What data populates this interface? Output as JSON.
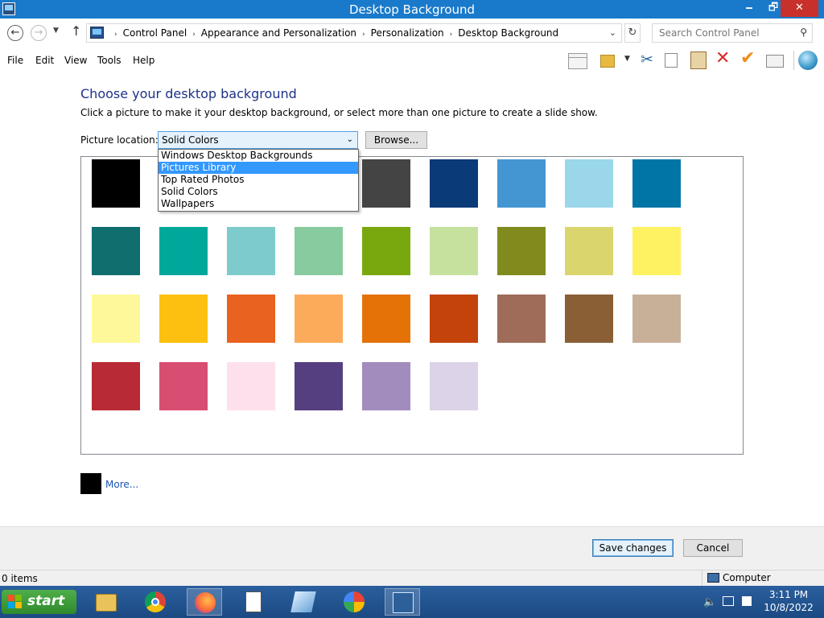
{
  "window": {
    "title": "Desktop Background",
    "minimize": "🗕",
    "maximize": "🗗",
    "close": "✕"
  },
  "address": {
    "crumbs": [
      "Control Panel",
      "Appearance and Personalization",
      "Personalization",
      "Desktop Background"
    ],
    "search_placeholder": "Search Control Panel"
  },
  "menu": {
    "file": "File",
    "edit": "Edit",
    "view": "View",
    "tools": "Tools",
    "help": "Help"
  },
  "main": {
    "heading": "Choose your desktop background",
    "subtext": "Click a picture to make it your desktop background, or select more than one picture to create a slide show.",
    "picture_location_label": "Picture location:",
    "picture_location_value": "Solid Colors",
    "browse_label": "Browse...",
    "dropdown_options": [
      "Windows Desktop Backgrounds",
      "Pictures Library",
      "Top Rated Photos",
      "Solid Colors",
      "Wallpapers"
    ],
    "dropdown_highlighted": "Pictures Library",
    "more_label": "More...",
    "more_color": "#000000"
  },
  "swatches": [
    [
      "#000000",
      "#ffffff",
      "#ffffff",
      "#ffffff",
      "#444444",
      "#0a3a78",
      "#4496d2",
      "#9bd7ea",
      "#0075a6"
    ],
    [
      "#106e6e",
      "#00a89c",
      "#7ecbcb",
      "#87cb9f",
      "#78a80d",
      "#c6e09e",
      "#818a1d",
      "#dbd56e",
      "#fef263"
    ],
    [
      "#fef89a",
      "#fdc010",
      "#ea621f",
      "#fcab5b",
      "#e57206",
      "#c3430a",
      "#9e6c58",
      "#8a5f36",
      "#c8b098"
    ],
    [
      "#b92a37",
      "#d84d72",
      "#fde0ec",
      "#553f80",
      "#a28bbd",
      "#dcd3e8"
    ]
  ],
  "footer": {
    "save_label": "Save changes",
    "cancel_label": "Cancel"
  },
  "status": {
    "items": "0 items",
    "location": "Computer"
  },
  "taskbar": {
    "start_label": "start",
    "time": "3:11 PM",
    "date": "10/8/2022"
  }
}
